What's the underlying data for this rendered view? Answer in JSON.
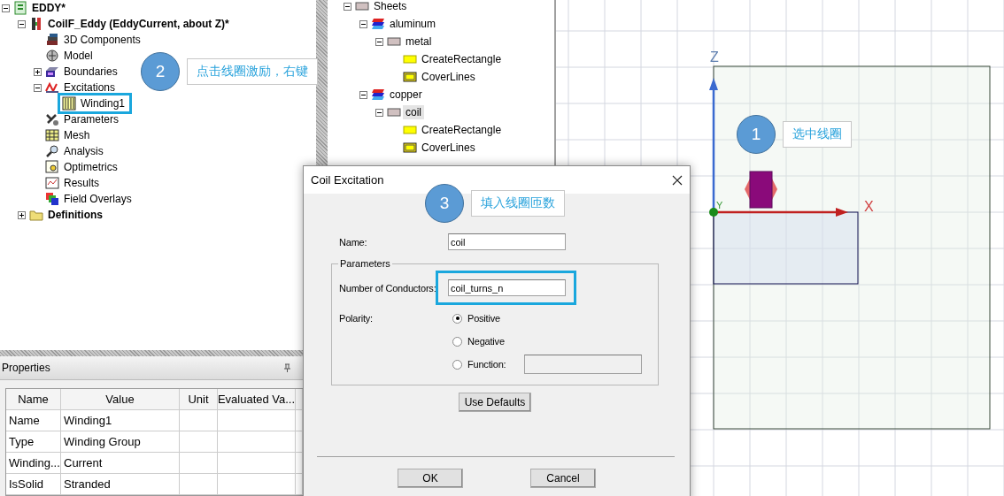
{
  "left_tree": {
    "items": [
      {
        "label": "EDDY*",
        "kind": "project",
        "expanded": true,
        "selected": false,
        "children": [
          {
            "label": "CoilF_Eddy (EddyCurrent, about Z)*",
            "kind": "design",
            "expanded": true,
            "selected": false,
            "children": [
              {
                "label": "3D Components",
                "kind": "components",
                "selected": false
              },
              {
                "label": "Model",
                "kind": "model",
                "selected": false
              },
              {
                "label": "Boundaries",
                "kind": "boundaries",
                "expanded": false,
                "selected": false
              },
              {
                "label": "Excitations",
                "kind": "excitations",
                "expanded": true,
                "selected": false,
                "children": [
                  {
                    "label": "Winding1",
                    "kind": "winding",
                    "selected": false,
                    "highlighted": true
                  }
                ]
              },
              {
                "label": "Parameters",
                "kind": "parameters",
                "selected": false
              },
              {
                "label": "Mesh",
                "kind": "mesh",
                "selected": false
              },
              {
                "label": "Analysis",
                "kind": "analysis",
                "selected": false
              },
              {
                "label": "Optimetrics",
                "kind": "optimetrics",
                "selected": false
              },
              {
                "label": "Results",
                "kind": "results",
                "selected": false
              },
              {
                "label": "Field Overlays",
                "kind": "overlays",
                "selected": false
              }
            ]
          },
          {
            "label": "Definitions",
            "kind": "folder",
            "expanded": false,
            "selected": false
          }
        ]
      }
    ]
  },
  "model_tree": {
    "items": [
      {
        "label": "Sheets",
        "kind": "sheet",
        "expanded": true,
        "selected": false,
        "children": [
          {
            "label": "aluminum",
            "kind": "material",
            "expanded": true,
            "selected": false,
            "children": [
              {
                "label": "metal",
                "kind": "sheet",
                "expanded": true,
                "selected": false,
                "children": [
                  {
                    "label": "CreateRectangle",
                    "kind": "operation",
                    "selected": false
                  },
                  {
                    "label": "CoverLines",
                    "kind": "cover",
                    "selected": false
                  }
                ]
              }
            ]
          },
          {
            "label": "copper",
            "kind": "material",
            "expanded": true,
            "selected": false,
            "children": [
              {
                "label": "coil",
                "kind": "sheet",
                "expanded": true,
                "selected": true,
                "children": [
                  {
                    "label": "CreateRectangle",
                    "kind": "operation",
                    "selected": false
                  },
                  {
                    "label": "CoverLines",
                    "kind": "cover",
                    "selected": false
                  }
                ]
              }
            ]
          }
        ]
      }
    ]
  },
  "properties": {
    "title": "Properties",
    "columns": [
      "Name",
      "Value",
      "Unit",
      "Evaluated Va..."
    ],
    "rows": [
      {
        "name": "Name",
        "value": "Winding1"
      },
      {
        "name": "Type",
        "value": "Winding Group"
      },
      {
        "name": "Winding...",
        "value": "Current"
      },
      {
        "name": "IsSolid",
        "value": "Stranded"
      }
    ]
  },
  "viewport": {
    "x_label": "X",
    "y_label": "Y",
    "z_label": "Z"
  },
  "dialog": {
    "title": "Coil Excitation",
    "name_label": "Name:",
    "name_value": "coil",
    "group_title": "Parameters",
    "conductors_label": "Number of Conductors:",
    "conductors_value": "coil_turns_n",
    "conductors_highlighted": true,
    "polarity_label": "Polarity:",
    "polarity_options": [
      {
        "label": "Positive",
        "selected": true
      },
      {
        "label": "Negative",
        "selected": false
      },
      {
        "label": "Function:",
        "selected": false
      }
    ],
    "use_defaults": "Use Defaults",
    "buttons": [
      "OK",
      "Cancel"
    ]
  },
  "annotations": [
    {
      "number": "1",
      "text": "选中线圈"
    },
    {
      "number": "2",
      "text": "点击线圈激励，右键"
    },
    {
      "number": "3",
      "text": "填入线圈匝数"
    }
  ]
}
